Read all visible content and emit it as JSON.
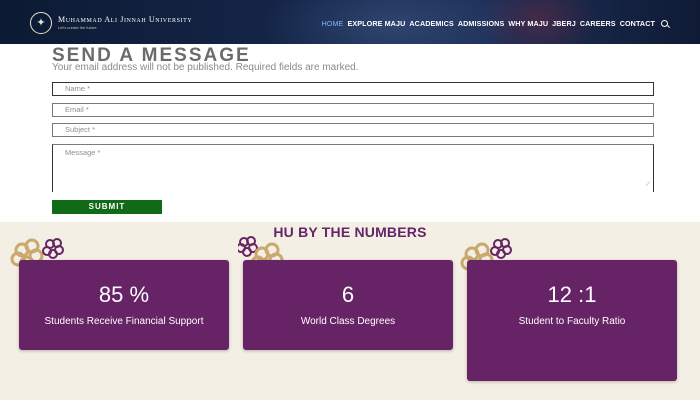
{
  "header": {
    "brand_name": "Muhammad Ali Jinnah University",
    "tagline": "Let's create the future",
    "nav": [
      {
        "label": "HOME",
        "active": true
      },
      {
        "label": "EXPLORE MAJU",
        "active": false
      },
      {
        "label": "ACADEMICS",
        "active": false
      },
      {
        "label": "ADMISSIONS",
        "active": false
      },
      {
        "label": "WHY MAJU",
        "active": false
      },
      {
        "label": "JBERJ",
        "active": false
      },
      {
        "label": "CAREERS",
        "active": false
      },
      {
        "label": "CONTACT",
        "active": false
      }
    ]
  },
  "form": {
    "title": "SEND A MESSAGE",
    "note": "Your email address will not be published. Required fields are marked.",
    "name_placeholder": "Name *",
    "email_placeholder": "Email *",
    "subject_placeholder": "Subject *",
    "message_placeholder": "Message *",
    "submit_label": "SUBMIT"
  },
  "numbers": {
    "title": "HU BY THE NUMBERS",
    "cards": [
      {
        "value": "85 %",
        "label": "Students Receive Financial Support"
      },
      {
        "value": "6",
        "label": "World Class Degrees"
      },
      {
        "value": "12 :1",
        "label": "Student to Faculty Ratio"
      }
    ]
  },
  "colors": {
    "header_bg": "#15264a",
    "accent_purple": "#662365",
    "submit_green": "#116a18",
    "active_nav": "#7fb2ff",
    "section_bg": "#f4efe4"
  }
}
